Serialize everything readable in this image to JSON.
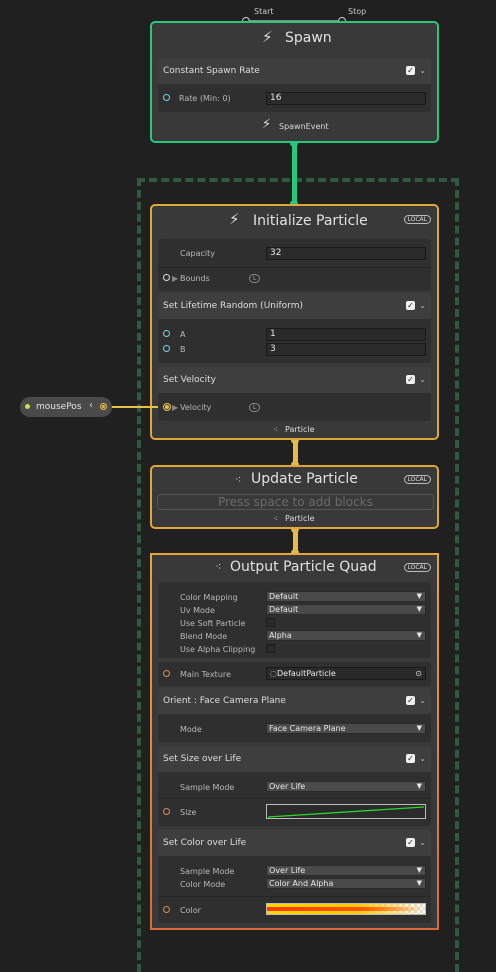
{
  "spawn": {
    "flow_start": "Start",
    "flow_stop": "Stop",
    "title": "Spawn",
    "block": {
      "title": "Constant Spawn Rate",
      "rate_label": "Rate (Min: 0)",
      "rate_value": "16"
    },
    "event_label": "SpawnEvent"
  },
  "initialize": {
    "title": "Initialize Particle",
    "badge": "LOCAL",
    "capacity_label": "Capacity",
    "capacity_value": "32",
    "bounds_label": "Bounds",
    "bounds_badge": "L",
    "lifetime": {
      "title": "Set Lifetime Random (Uniform)",
      "a_label": "A",
      "a_value": "1",
      "b_label": "B",
      "b_value": "3"
    },
    "velocity": {
      "title": "Set Velocity",
      "velocity_label": "Velocity",
      "badge": "L"
    },
    "footer": "Particle"
  },
  "mouse_node": {
    "label": "mousePos",
    "chevron": "‹"
  },
  "update": {
    "title": "Update Particle",
    "badge": "LOCAL",
    "placeholder": "Press space to add blocks",
    "footer": "Particle"
  },
  "output": {
    "title": "Output Particle Quad",
    "badge": "LOCAL",
    "settings": {
      "color_mapping_label": "Color Mapping",
      "color_mapping_value": "Default",
      "uv_mode_label": "Uv Mode",
      "uv_mode_value": "Default",
      "soft_particle_label": "Use Soft Particle",
      "blend_mode_label": "Blend Mode",
      "blend_mode_value": "Alpha",
      "alpha_clipping_label": "Use Alpha Clipping"
    },
    "main_texture_label": "Main Texture",
    "main_texture_value": "DefaultParticle",
    "orient": {
      "title": "Orient : Face Camera Plane",
      "mode_label": "Mode",
      "mode_value": "Face Camera Plane"
    },
    "size_over_life": {
      "title": "Set Size over Life",
      "sample_mode_label": "Sample Mode",
      "sample_mode_value": "Over Life",
      "size_label": "Size"
    },
    "color_over_life": {
      "title": "Set Color over Life",
      "sample_mode_label": "Sample Mode",
      "sample_mode_value": "Over Life",
      "color_mode_label": "Color Mode",
      "color_mode_value": "Color And Alpha",
      "color_label": "Color"
    }
  },
  "colors": {
    "spawn_border": "#26c97b",
    "particle_border": "#e0a637",
    "output_border": "#e08a3e",
    "background": "#202020",
    "node_body": "#393939"
  }
}
